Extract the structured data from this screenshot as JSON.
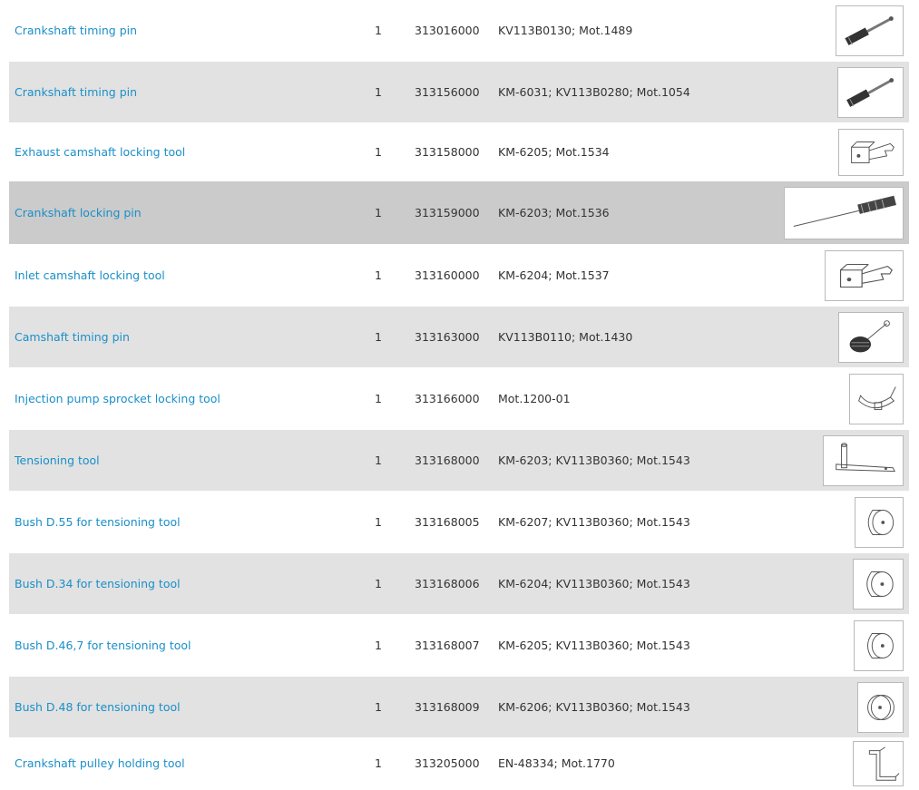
{
  "table": {
    "rows": [
      {
        "name": "Crankshaft timing pin",
        "qty": "1",
        "code": "313016000",
        "refs": "KV113B0130; Mot.1489",
        "icon": "crankshaft-timing-pin-icon",
        "style": "odd"
      },
      {
        "name": "Crankshaft timing pin",
        "qty": "1",
        "code": "313156000",
        "refs": "KM-6031; KV113B0280; Mot.1054",
        "icon": "crankshaft-timing-pin-icon",
        "style": "even"
      },
      {
        "name": "Exhaust camshaft locking tool",
        "qty": "1",
        "code": "313158000",
        "refs": "KM-6205; Mot.1534",
        "icon": "camshaft-locking-tool-icon",
        "style": "odd"
      },
      {
        "name": "Crankshaft locking pin",
        "qty": "1",
        "code": "313159000",
        "refs": "KM-6203; Mot.1536",
        "icon": "crankshaft-locking-pin-icon",
        "style": "hl"
      },
      {
        "name": "Inlet camshaft locking tool",
        "qty": "1",
        "code": "313160000",
        "refs": "KM-6204; Mot.1537",
        "icon": "camshaft-locking-tool-icon",
        "style": "odd"
      },
      {
        "name": "Camshaft timing pin",
        "qty": "1",
        "code": "313163000",
        "refs": "KV113B0110; Mot.1430",
        "icon": "camshaft-timing-pin-icon",
        "style": "even"
      },
      {
        "name": "Injection pump sprocket locking tool",
        "qty": "1",
        "code": "313166000",
        "refs": "Mot.1200-01",
        "icon": "sprocket-locking-tool-icon",
        "style": "odd"
      },
      {
        "name": "Tensioning tool",
        "qty": "1",
        "code": "313168000",
        "refs": "KM-6203; KV113B0360; Mot.1543",
        "icon": "tensioning-tool-icon",
        "style": "even"
      },
      {
        "name": "Bush D.55 for tensioning tool",
        "qty": "1",
        "code": "313168005",
        "refs": "KM-6207; KV113B0360; Mot.1543",
        "icon": "bush-icon",
        "style": "odd"
      },
      {
        "name": "Bush D.34 for tensioning tool",
        "qty": "1",
        "code": "313168006",
        "refs": "KM-6204; KV113B0360; Mot.1543",
        "icon": "bush-icon",
        "style": "even"
      },
      {
        "name": "Bush D.46,7 for tensioning tool",
        "qty": "1",
        "code": "313168007",
        "refs": "KM-6205; KV113B0360; Mot.1543",
        "icon": "bush-icon",
        "style": "odd"
      },
      {
        "name": "Bush D.48 for tensioning tool",
        "qty": "1",
        "code": "313168009",
        "refs": "KM-6206; KV113B0360; Mot.1543",
        "icon": "bush-flat-icon",
        "style": "even"
      },
      {
        "name": "Crankshaft pulley holding tool",
        "qty": "1",
        "code": "313205000",
        "refs": "EN-48334; Mot.1770",
        "icon": "pulley-holding-tool-icon",
        "style": "odd"
      }
    ]
  }
}
